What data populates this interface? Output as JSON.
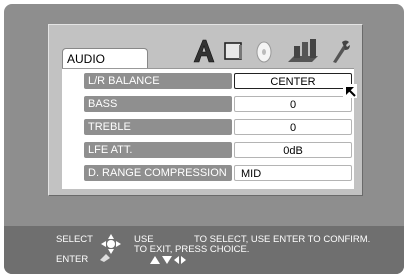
{
  "menu": {
    "tab_label": "AUDIO",
    "tab_icons": [
      "audio-a-icon",
      "display-icon",
      "disc-icon",
      "speaker-icon",
      "wrench-icon"
    ]
  },
  "rows": [
    {
      "name": "lr-balance",
      "label": "L/R BALANCE",
      "value": "CENTER",
      "selected": true
    },
    {
      "name": "bass",
      "label": "BASS",
      "value": "0"
    },
    {
      "name": "treble",
      "label": "TREBLE",
      "value": "0"
    },
    {
      "name": "lfe-att",
      "label": "LFE ATT.",
      "value": "0dB"
    },
    {
      "name": "d-range-compression",
      "label": "D. RANGE COMPRESSION",
      "value": "MID"
    }
  ],
  "footer": {
    "select_label": "SELECT",
    "enter_label": "ENTER",
    "use_label": "USE",
    "instruction": "TO SELECT, USE ENTER TO CONFIRM.",
    "exit_instruction": "TO EXIT, PRESS CHOICE."
  },
  "colors": {
    "background": "#8e8e8e",
    "panel": "#c2c2c2",
    "row_label_bg": "#8f8f8f",
    "bottom_bar": "#6f6f6f"
  }
}
